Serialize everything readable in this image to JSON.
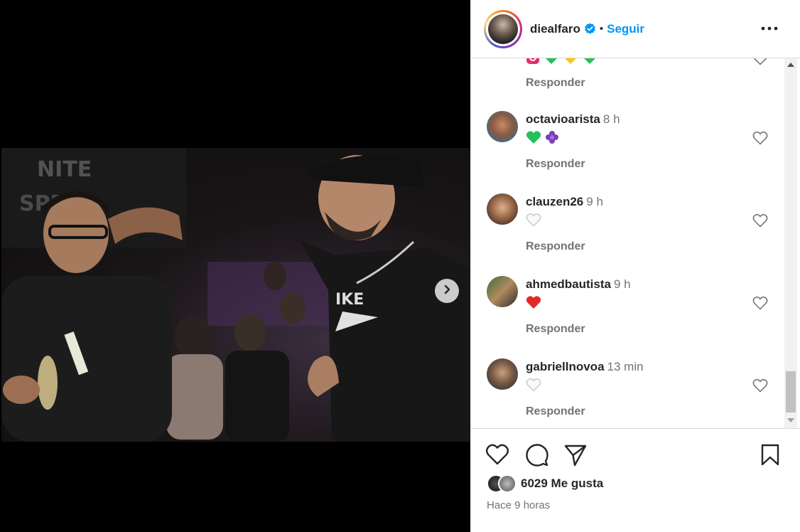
{
  "post": {
    "username": "diealfaro",
    "follow_label": "Seguir",
    "separator": "•",
    "likes": "6029 Me gusta",
    "time_ago": "Hace 9 horas"
  },
  "comments": [
    {
      "user": "octavioarista",
      "time": "8 h",
      "emojis": [
        "green-heart",
        "purple-flower"
      ],
      "reply": "Responder"
    },
    {
      "user": "clauzen26",
      "time": "9 h",
      "emojis": [
        "white-heart"
      ],
      "reply": "Responder"
    },
    {
      "user": "ahmedbautista",
      "time": "9 h",
      "emojis": [
        "red-heart"
      ],
      "reply": "Responder"
    },
    {
      "user": "gabriellnovoa",
      "time": "13 min",
      "emojis": [
        "white-heart"
      ],
      "reply": "Responder"
    }
  ],
  "partial_comment": {
    "emojis": [
      "instagram-icon",
      "green-heart",
      "yellow-heart",
      "green-heart"
    ],
    "reply": "Responder"
  },
  "icons": {
    "more": "more-options-icon",
    "like": "heart-icon",
    "comment": "comment-icon",
    "share": "send-icon",
    "save": "bookmark-icon",
    "next": "chevron-right-icon",
    "verified": "verified-badge-icon"
  },
  "colors": {
    "accent": "#0095f6",
    "secondary_text": "#737373",
    "heart_red": "#ed4956",
    "heart_green": "#25c05a",
    "heart_yellow": "#f8c51d"
  }
}
